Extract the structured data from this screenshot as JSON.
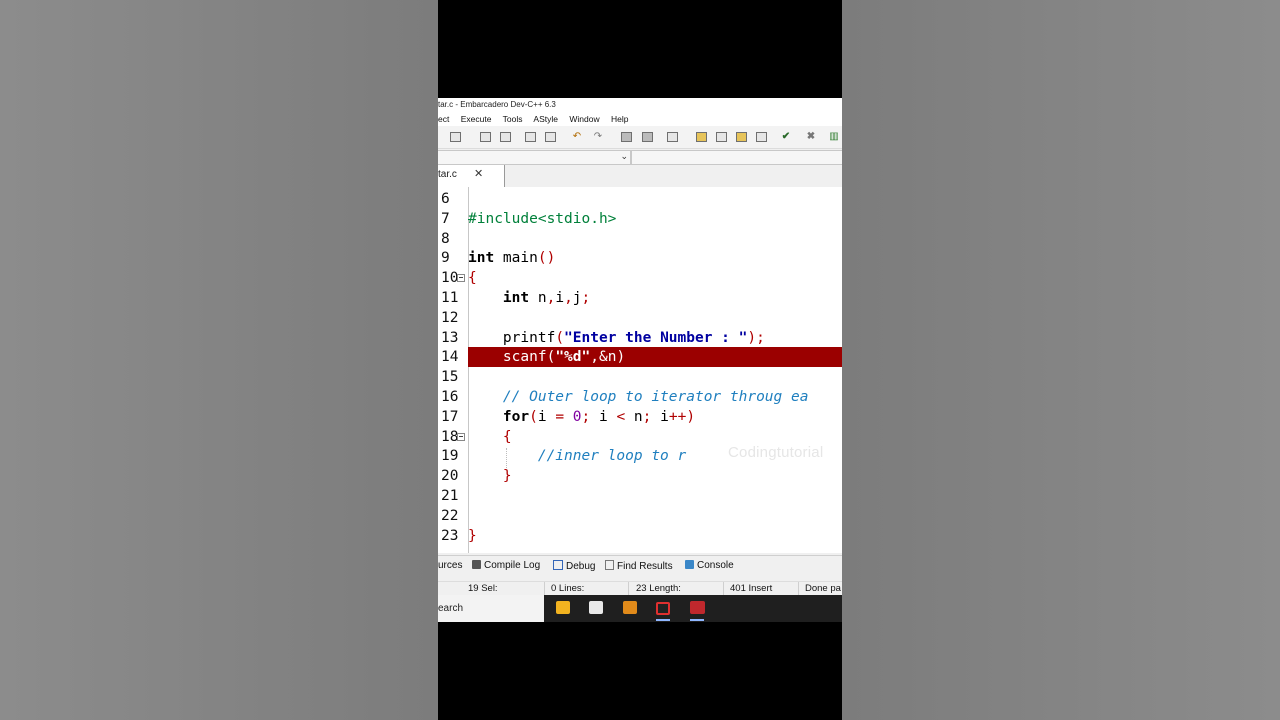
{
  "window": {
    "title": "tar.c - Embarcadero Dev-C++ 6.3"
  },
  "menu": [
    "ect",
    "Execute",
    "Tools",
    "AStyle",
    "Window",
    "Help"
  ],
  "editor_tab": {
    "label": "tar.c",
    "close": "✕"
  },
  "code_lines": [
    {
      "num": "6",
      "fold": false,
      "tokens": []
    },
    {
      "num": "7",
      "fold": false,
      "tokens": [
        [
          "pre",
          "#include<stdio.h>"
        ]
      ]
    },
    {
      "num": "8",
      "fold": false,
      "tokens": []
    },
    {
      "num": "9",
      "fold": false,
      "tokens": [
        [
          "kw",
          "int"
        ],
        [
          "id",
          " main"
        ],
        [
          "op",
          "()"
        ]
      ]
    },
    {
      "num": "10",
      "fold": true,
      "tokens": [
        [
          "op",
          "{"
        ]
      ]
    },
    {
      "num": "11",
      "fold": false,
      "tokens": [
        [
          "id",
          "    "
        ],
        [
          "kw",
          "int"
        ],
        [
          "id",
          " n"
        ],
        [
          "op",
          ","
        ],
        [
          "id",
          "i"
        ],
        [
          "op",
          ","
        ],
        [
          "id",
          "j"
        ],
        [
          "op",
          ";"
        ]
      ]
    },
    {
      "num": "12",
      "fold": false,
      "tokens": []
    },
    {
      "num": "13",
      "fold": false,
      "tokens": [
        [
          "id",
          "    printf"
        ],
        [
          "op",
          "("
        ],
        [
          "str",
          "\"Enter the Number : \""
        ],
        [
          "op",
          ");"
        ]
      ]
    },
    {
      "num": "14",
      "fold": false,
      "highlight": true,
      "tokens": [
        [
          "id",
          "    scanf"
        ],
        [
          "op",
          "("
        ],
        [
          "str",
          "\"%d\""
        ],
        [
          "op",
          ","
        ],
        [
          "id",
          "&n"
        ],
        [
          "op",
          ")"
        ]
      ]
    },
    {
      "num": "15",
      "fold": false,
      "tokens": []
    },
    {
      "num": "16",
      "fold": false,
      "tokens": [
        [
          "cm",
          "    // Outer loop to iterator throug ea"
        ]
      ]
    },
    {
      "num": "17",
      "fold": false,
      "tokens": [
        [
          "id",
          "    "
        ],
        [
          "kw",
          "for"
        ],
        [
          "op",
          "("
        ],
        [
          "id",
          "i "
        ],
        [
          "op",
          "="
        ],
        [
          "id",
          " "
        ],
        [
          "num",
          "0"
        ],
        [
          "op",
          ";"
        ],
        [
          "id",
          " i "
        ],
        [
          "op",
          "<"
        ],
        [
          "id",
          " n"
        ],
        [
          "op",
          ";"
        ],
        [
          "id",
          " i"
        ],
        [
          "op",
          "++)"
        ]
      ]
    },
    {
      "num": "18",
      "fold": true,
      "tokens": [
        [
          "id",
          "    "
        ],
        [
          "op",
          "{"
        ]
      ]
    },
    {
      "num": "19",
      "fold": false,
      "tokens": [
        [
          "cm",
          "        //inner loop to r"
        ]
      ]
    },
    {
      "num": "20",
      "fold": false,
      "tokens": [
        [
          "id",
          "    "
        ],
        [
          "op",
          "}"
        ]
      ]
    },
    {
      "num": "21",
      "fold": false,
      "tokens": []
    },
    {
      "num": "22",
      "fold": false,
      "tokens": []
    },
    {
      "num": "23",
      "fold": false,
      "tokens": [
        [
          "op",
          "}"
        ]
      ]
    }
  ],
  "watermark": "Codingtutorial",
  "bottom_tabs": [
    "urces",
    "Compile Log",
    "Debug",
    "Find Results",
    "Console"
  ],
  "status": {
    "sel": "19 Sel:",
    "lines": "0 Lines:",
    "length": "23 Length:",
    "insert": "401 Insert",
    "done": "Done pa"
  },
  "taskbar": {
    "search": "earch"
  }
}
